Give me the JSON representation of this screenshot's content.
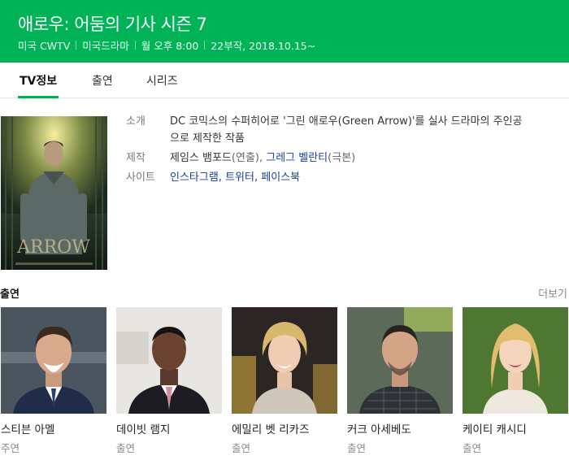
{
  "header": {
    "title": "애로우: 어둠의 기사 시즌 7",
    "meta": [
      "미국 CWTV",
      "미국드라마",
      "월 오후 8:00",
      "22부작, 2018.10.15~"
    ],
    "accent_color": "#00b357"
  },
  "tabs": [
    {
      "label": "TV정보",
      "active": true
    },
    {
      "label": "출연",
      "active": false
    },
    {
      "label": "시리즈",
      "active": false
    }
  ],
  "poster": {
    "text": "ARROW"
  },
  "info": {
    "intro_label": "소개",
    "intro_text": "DC 코믹스의 수퍼히어로 '그린 애로우(Green Arrow)'를 실사 드라마의 주인공으로 제작한 작품",
    "production_label": "제작",
    "producer1": "제임스 뱀포드",
    "producer1_role": "(연출),",
    "producer2": "그레그 벨란티",
    "producer2_role": "(극본)",
    "site_label": "사이트",
    "sites": [
      "인스타그램",
      "트위터",
      "페이스북"
    ],
    "site_separator": ","
  },
  "cast_section": {
    "heading": "출연",
    "more": "더보기",
    "members": [
      {
        "name": "스티븐 아멜",
        "role": "주연"
      },
      {
        "name": "데이빗 램지",
        "role": "출연"
      },
      {
        "name": "에밀리 벳 리카즈",
        "role": "출연"
      },
      {
        "name": "커크 아세베도",
        "role": "출연"
      },
      {
        "name": "케이티 캐시디",
        "role": "출연"
      }
    ]
  }
}
